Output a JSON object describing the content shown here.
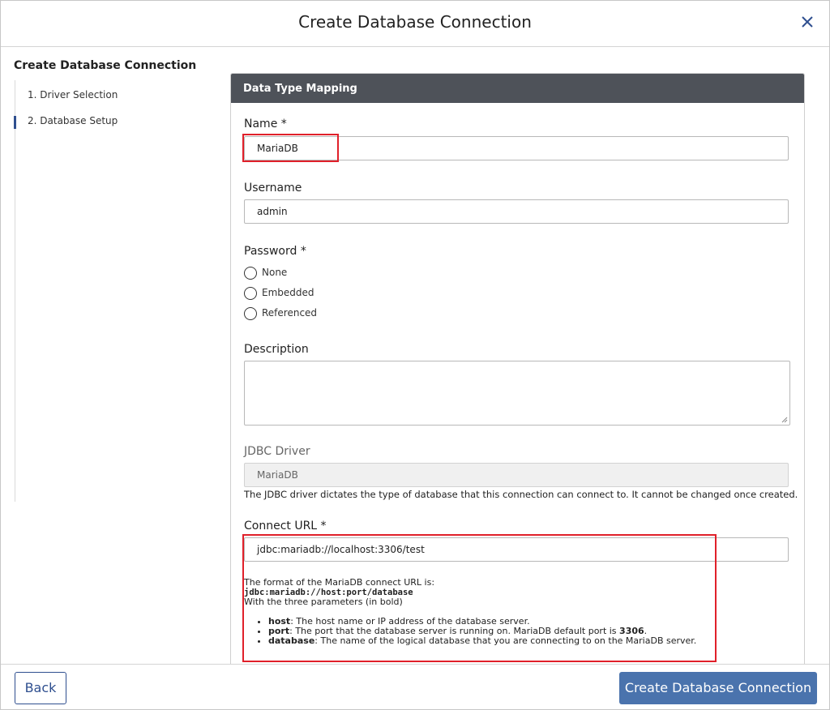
{
  "dialog": {
    "title": "Create Database Connection"
  },
  "sidebar": {
    "title": "Create Database Connection",
    "steps": [
      {
        "label": "1. Driver Selection"
      },
      {
        "label": "2. Database Setup"
      }
    ],
    "active_step": 1
  },
  "panel": {
    "header": "Data Type Mapping",
    "name": {
      "label": "Name *",
      "value": "MariaDB"
    },
    "username": {
      "label": "Username",
      "value": "admin"
    },
    "password": {
      "label": "Password *",
      "options": [
        {
          "label": "None"
        },
        {
          "label": "Embedded"
        },
        {
          "label": "Referenced"
        }
      ]
    },
    "description": {
      "label": "Description",
      "value": ""
    },
    "jdbc_driver": {
      "label": "JDBC Driver",
      "value": "MariaDB",
      "help": "The JDBC driver dictates the type of database that this connection can connect to. It cannot be changed once created."
    },
    "connect_url": {
      "label": "Connect URL *",
      "value": "jdbc:mariadb://localhost:3306/test",
      "help_intro": "The format of the MariaDB connect URL is:",
      "help_format": "jdbc:mariadb://host:port/database",
      "help_params": "With the three parameters (in bold)",
      "params": [
        {
          "name": "host",
          "desc": ": The host name or IP address of the database server."
        },
        {
          "name": "port",
          "desc": ": The port that the database server is running on. MariaDB default port is ",
          "bold_value": "3306",
          "tail": "."
        },
        {
          "name": "database",
          "desc": ": The name of the logical database that you are connecting to on the MariaDB server."
        }
      ]
    }
  },
  "footer": {
    "back_label": "Back",
    "create_label": "Create Database Connection"
  },
  "colors": {
    "accent": "#4a73ad",
    "header_bar": "#4e5259",
    "highlight": "#e0202a"
  }
}
